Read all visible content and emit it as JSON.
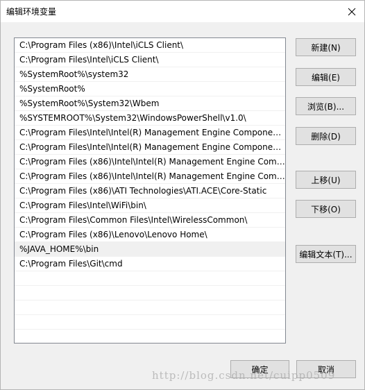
{
  "window": {
    "title": "编辑环境变量"
  },
  "path_list": {
    "items": [
      "C:\\Program Files (x86)\\Intel\\iCLS Client\\",
      "C:\\Program Files\\Intel\\iCLS Client\\",
      "%SystemRoot%\\system32",
      "%SystemRoot%",
      "%SystemRoot%\\System32\\Wbem",
      "%SYSTEMROOT%\\System32\\WindowsPowerShell\\v1.0\\",
      "C:\\Program Files\\Intel\\Intel(R) Management Engine Component...",
      "C:\\Program Files\\Intel\\Intel(R) Management Engine Component...",
      "C:\\Program Files (x86)\\Intel\\Intel(R) Management Engine Compo...",
      "C:\\Program Files (x86)\\Intel\\Intel(R) Management Engine Comp...",
      "C:\\Program Files (x86)\\ATI Technologies\\ATI.ACE\\Core-Static",
      "C:\\Program Files\\Intel\\WiFi\\bin\\",
      "C:\\Program Files\\Common Files\\Intel\\WirelessCommon\\",
      "C:\\Program Files (x86)\\Lenovo\\Lenovo Home\\",
      "%JAVA_HOME%\\bin",
      "C:\\Program Files\\Git\\cmd"
    ],
    "selected_index": 14
  },
  "buttons": {
    "new": "新建(N)",
    "edit": "编辑(E)",
    "browse": "浏览(B)...",
    "delete": "删除(D)",
    "move_up": "上移(U)",
    "move_down": "下移(O)",
    "edit_text": "编辑文本(T)...",
    "ok": "确定",
    "cancel": "取消"
  },
  "watermark": "http://blog.csdn.net/cuipp0509"
}
